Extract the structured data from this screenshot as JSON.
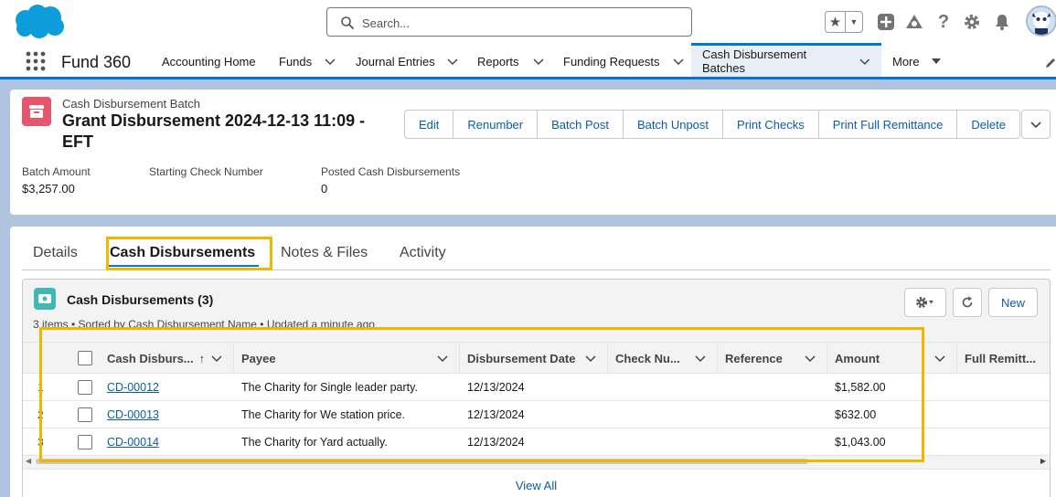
{
  "header": {
    "search_placeholder": "Search..."
  },
  "nav": {
    "app_name": "Fund 360",
    "items": [
      {
        "label": "Accounting Home",
        "has_menu": false
      },
      {
        "label": "Funds",
        "has_menu": true
      },
      {
        "label": "Journal Entries",
        "has_menu": true
      },
      {
        "label": "Reports",
        "has_menu": true
      },
      {
        "label": "Funding Requests",
        "has_menu": true
      },
      {
        "label": "Cash Disbursement Batches",
        "has_menu": true,
        "active": true
      },
      {
        "label": "More",
        "has_menu": true
      }
    ]
  },
  "record": {
    "object_type": "Cash Disbursement Batch",
    "title": "Grant Disbursement 2024-12-13 11:09 - EFT",
    "actions": [
      "Edit",
      "Renumber",
      "Batch Post",
      "Batch Unpost",
      "Print Checks",
      "Print Full Remittance",
      "Delete"
    ],
    "fields": [
      {
        "label": "Batch Amount",
        "value": "$3,257.00"
      },
      {
        "label": "Starting Check Number",
        "value": ""
      },
      {
        "label": "Posted Cash Disbursements",
        "value": "0"
      }
    ]
  },
  "tabs": [
    "Details",
    "Cash Disbursements",
    "Notes & Files",
    "Activity"
  ],
  "related_list": {
    "title": "Cash Disbursements (3)",
    "subtitle": "3 items • Sorted by Cash Disbursement Name • Updated a minute ago",
    "new_label": "New",
    "columns": [
      "Cash Disburs...",
      "Payee",
      "Disbursement Date",
      "Check Nu...",
      "Reference",
      "Amount",
      "Full Remitt..."
    ],
    "rows": [
      {
        "num": "1",
        "name": "CD-00012",
        "payee": "The Charity for Single leader party.",
        "date": "12/13/2024",
        "check": "",
        "reference": "",
        "amount": "$1,582.00"
      },
      {
        "num": "2",
        "name": "CD-00013",
        "payee": "The Charity for We station price.",
        "date": "12/13/2024",
        "check": "",
        "reference": "",
        "amount": "$632.00"
      },
      {
        "num": "3",
        "name": "CD-00014",
        "payee": "The Charity for Yard actually.",
        "date": "12/13/2024",
        "check": "",
        "reference": "",
        "amount": "$1,043.00"
      }
    ],
    "view_all": "View All"
  },
  "colors": {
    "brand_blue": "#0176d3",
    "link_blue": "#0b5cab",
    "highlight": "#f4b400",
    "record_icon": "#e3566b",
    "list_icon": "#3fb9b2"
  }
}
